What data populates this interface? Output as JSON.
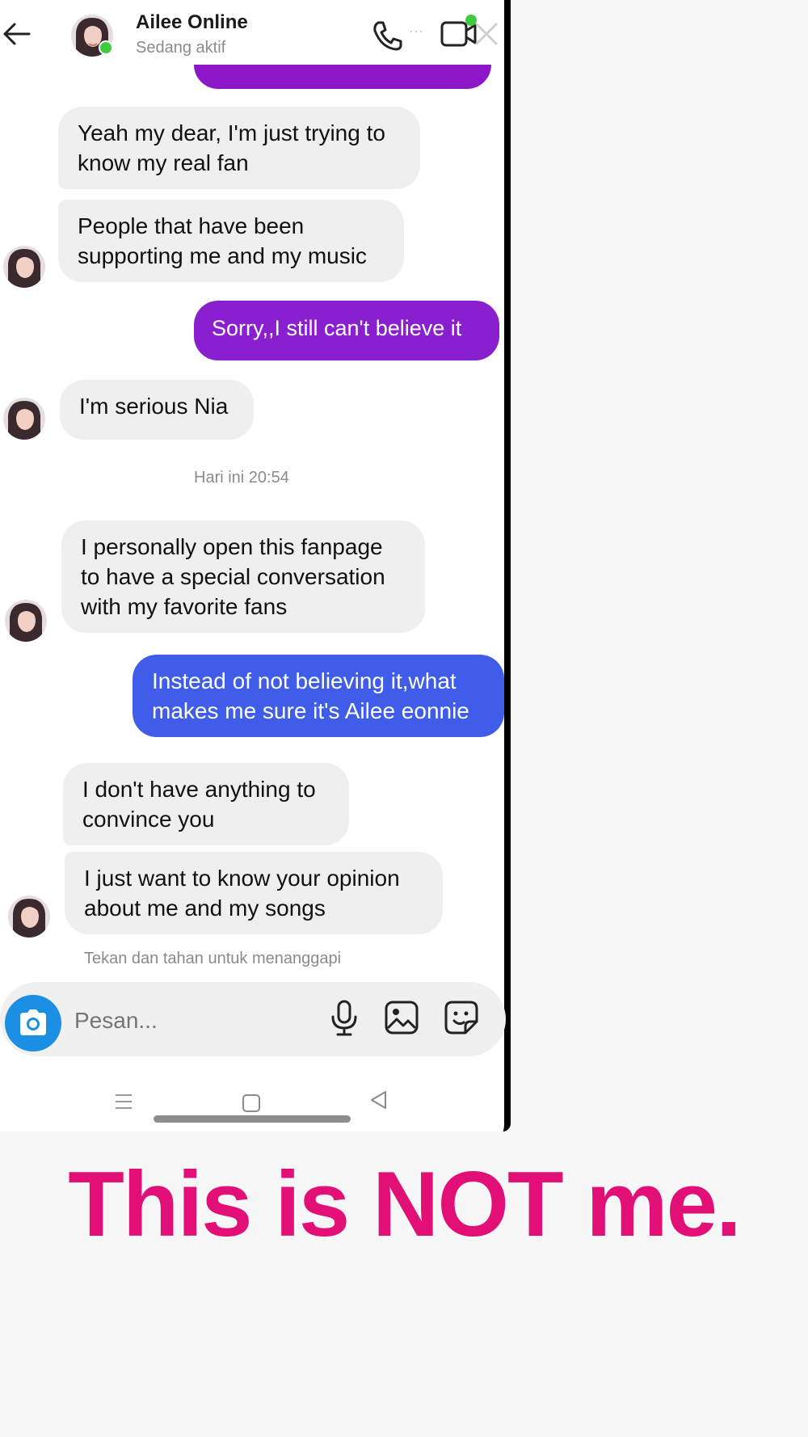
{
  "header": {
    "contact_name": "Ailee Online",
    "status": "Sedang aktif",
    "more_glyph": "···",
    "icons": [
      "back-arrow-icon",
      "phone-icon",
      "more-icon",
      "video-icon",
      "close-icon"
    ]
  },
  "messages": [
    {
      "direction": "incoming",
      "text": "Yeah my dear, I'm just trying to know my real fan"
    },
    {
      "direction": "incoming",
      "text": "People that have been supporting me and my music"
    },
    {
      "direction": "outgoing",
      "text": "Sorry,,I still can't believe it",
      "color": "#8a1fd0"
    },
    {
      "direction": "incoming",
      "text": "I'm serious Nia"
    },
    {
      "direction": "incoming",
      "text": "I personally open this fanpage to have a special conversation with my favorite fans"
    },
    {
      "direction": "outgoing",
      "text": "Instead of not believing it,what makes me sure it's Ailee eonnie",
      "color": "#3f5de8"
    },
    {
      "direction": "incoming",
      "text": "I don't have anything to convince you"
    },
    {
      "direction": "incoming",
      "text": "I just want to know your opinion about me and my songs"
    }
  ],
  "timestamp": "Hari ini 20:54",
  "hint": "Tekan dan tahan untuk menanggapi",
  "composer": {
    "placeholder": "Pesan...",
    "icons": [
      "camera-icon",
      "microphone-icon",
      "gallery-icon",
      "sticker-icon"
    ]
  },
  "nav": {
    "icons": [
      "menu-icon",
      "home-square-icon",
      "back-triangle-icon"
    ]
  },
  "caption": "This is NOT me.",
  "colors": {
    "accent_purple": "#8a1fd0",
    "accent_blue": "#3f5de8",
    "online_green": "#3ecb3e",
    "caption_pink": "#e20f77",
    "camera_blue": "#1a8fe3"
  }
}
